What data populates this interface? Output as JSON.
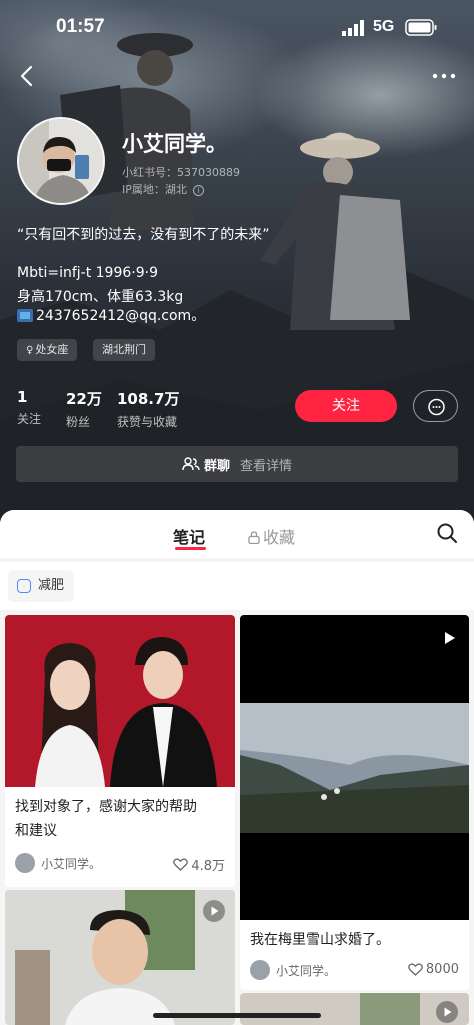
{
  "status_bar": {
    "time": "01:57",
    "network": "5G"
  },
  "profile": {
    "nickname": "小艾同学。",
    "user_id": "小红书号：537030889",
    "ip_location": "IP属地：湖北",
    "bio": {
      "quote": "“只有回不到的过去，没有到不了的未来”",
      "mbti": "Mbti=infj-t  1996·9·9",
      "body": "身高170cm、体重63.3kg",
      "email": "2437652412@qq.com。"
    },
    "tags": [
      {
        "icon": "female-icon",
        "label": "处女座"
      },
      {
        "label": "湖北荆门"
      }
    ],
    "stats": [
      {
        "value": "1",
        "label": "关注"
      },
      {
        "value": "22万",
        "label": "粉丝"
      },
      {
        "value": "108.7万",
        "label": "获赞与收藏"
      }
    ],
    "follow_label": "关注",
    "group_chat": {
      "label": "群聊",
      "detail": "查看详情"
    }
  },
  "tabs": {
    "notes": "笔记",
    "favorites": "收藏"
  },
  "filter": {
    "label": "减肥"
  },
  "cards": [
    {
      "title_line1": "找到对象了，感谢大家的帮助",
      "title_line2": "和建议",
      "author": "小艾同学。",
      "likes": "4.8万",
      "has_video": false
    },
    {
      "title": "我在梅里雪山求婚了。",
      "author": "小艾同学。",
      "likes": "8000",
      "has_video": true
    },
    {
      "has_video": true
    },
    {
      "has_video": true
    }
  ],
  "colors": {
    "accent": "#ff2442",
    "hero_bg": "#2b3038",
    "filter_icon": "#4a8cf0"
  }
}
